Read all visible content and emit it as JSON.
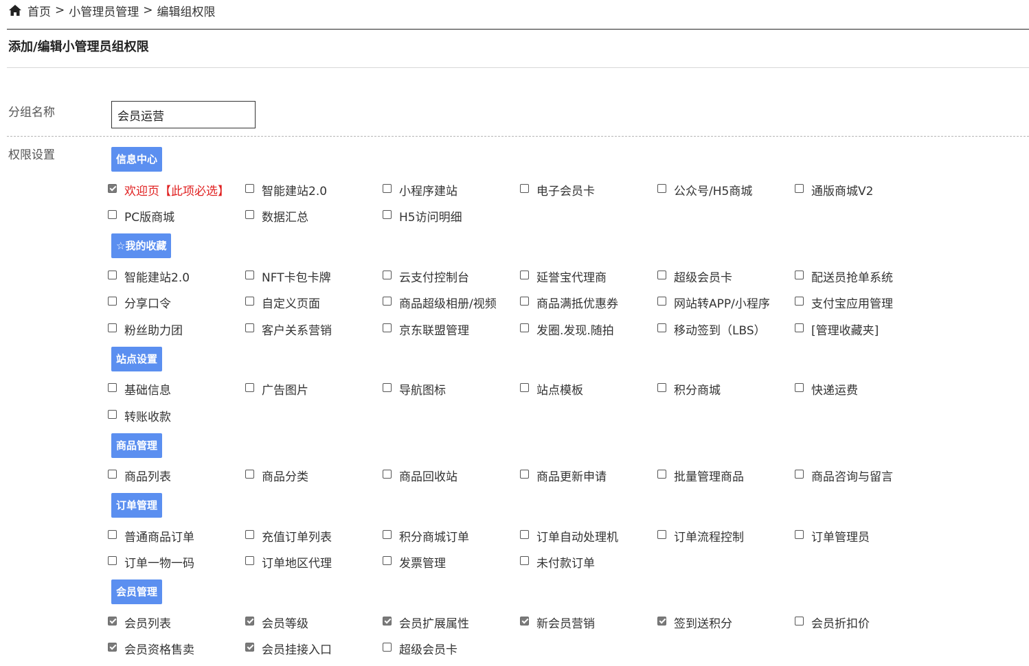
{
  "breadcrumb": {
    "home": "首页",
    "sep": ">",
    "level1": "小管理员管理",
    "level2": "编辑组权限"
  },
  "page": {
    "title": "添加/编辑小管理员组权限"
  },
  "form": {
    "group_name_label": "分组名称",
    "group_name_value": "会员运营",
    "permissions_label": "权限设置"
  },
  "colors": {
    "group_header_bg": "#5b8ff0",
    "required_text": "#e02020"
  },
  "groups": [
    {
      "title": "信息中心",
      "items": [
        {
          "label": "欢迎页【此项必选】",
          "checked": true,
          "required": true
        },
        {
          "label": "智能建站2.0",
          "checked": false
        },
        {
          "label": "小程序建站",
          "checked": false
        },
        {
          "label": "电子会员卡",
          "checked": false
        },
        {
          "label": "公众号/H5商城",
          "checked": false
        },
        {
          "label": "通版商城V2",
          "checked": false
        },
        {
          "label": "PC版商城",
          "checked": false
        },
        {
          "label": "数据汇总",
          "checked": false
        },
        {
          "label": "H5访问明细",
          "checked": false
        }
      ]
    },
    {
      "title": "☆我的收藏",
      "items": [
        {
          "label": "智能建站2.0",
          "checked": false
        },
        {
          "label": "NFT卡包卡牌",
          "checked": false
        },
        {
          "label": "云支付控制台",
          "checked": false
        },
        {
          "label": "延誉宝代理商",
          "checked": false
        },
        {
          "label": "超级会员卡",
          "checked": false
        },
        {
          "label": "配送员抢单系统",
          "checked": false
        },
        {
          "label": "分享口令",
          "checked": false
        },
        {
          "label": "自定义页面",
          "checked": false
        },
        {
          "label": "商品超级相册/视频",
          "checked": false
        },
        {
          "label": "商品满抵优惠券",
          "checked": false
        },
        {
          "label": "网站转APP/小程序",
          "checked": false
        },
        {
          "label": "支付宝应用管理",
          "checked": false
        },
        {
          "label": "粉丝助力团",
          "checked": false
        },
        {
          "label": "客户关系营销",
          "checked": false
        },
        {
          "label": "京东联盟管理",
          "checked": false
        },
        {
          "label": "发圈.发现.随拍",
          "checked": false
        },
        {
          "label": "移动签到（LBS）",
          "checked": false
        },
        {
          "label": "[管理收藏夹]",
          "checked": false
        }
      ]
    },
    {
      "title": "站点设置",
      "items": [
        {
          "label": "基础信息",
          "checked": false
        },
        {
          "label": "广告图片",
          "checked": false
        },
        {
          "label": "导航图标",
          "checked": false
        },
        {
          "label": "站点模板",
          "checked": false
        },
        {
          "label": "积分商城",
          "checked": false
        },
        {
          "label": "快递运费",
          "checked": false
        },
        {
          "label": "转账收款",
          "checked": false
        }
      ]
    },
    {
      "title": "商品管理",
      "items": [
        {
          "label": "商品列表",
          "checked": false
        },
        {
          "label": "商品分类",
          "checked": false
        },
        {
          "label": "商品回收站",
          "checked": false
        },
        {
          "label": "商品更新申请",
          "checked": false
        },
        {
          "label": "批量管理商品",
          "checked": false
        },
        {
          "label": "商品咨询与留言",
          "checked": false
        }
      ]
    },
    {
      "title": "订单管理",
      "items": [
        {
          "label": "普通商品订单",
          "checked": false
        },
        {
          "label": "充值订单列表",
          "checked": false
        },
        {
          "label": "积分商城订单",
          "checked": false
        },
        {
          "label": "订单自动处理机",
          "checked": false
        },
        {
          "label": "订单流程控制",
          "checked": false
        },
        {
          "label": "订单管理员",
          "checked": false
        },
        {
          "label": "订单一物一码",
          "checked": false
        },
        {
          "label": "订单地区代理",
          "checked": false
        },
        {
          "label": "发票管理",
          "checked": false
        },
        {
          "label": "未付款订单",
          "checked": false
        }
      ]
    },
    {
      "title": "会员管理",
      "items": [
        {
          "label": "会员列表",
          "checked": true
        },
        {
          "label": "会员等级",
          "checked": true
        },
        {
          "label": "会员扩展属性",
          "checked": true
        },
        {
          "label": "新会员营销",
          "checked": true
        },
        {
          "label": "签到送积分",
          "checked": true
        },
        {
          "label": "会员折扣价",
          "checked": false
        },
        {
          "label": "会员资格售卖",
          "checked": true
        },
        {
          "label": "会员挂接入口",
          "checked": true
        },
        {
          "label": "超级会员卡",
          "checked": false
        }
      ]
    }
  ]
}
